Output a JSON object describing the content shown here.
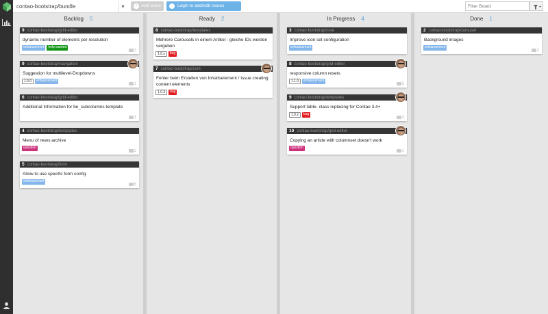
{
  "topbar": {
    "repo": "contao-bootstrap/bundle",
    "add_issue": "Add Issue",
    "login": "Login to add/edit issues",
    "filter_placeholder": "Filter Board"
  },
  "columns": [
    {
      "title": "Backlog",
      "count": "5"
    },
    {
      "title": "Ready",
      "count": "2"
    },
    {
      "title": "In Progress",
      "count": "4"
    },
    {
      "title": "Done",
      "count": "1"
    }
  ],
  "cards": {
    "backlog": [
      {
        "num": "9",
        "repo": "contao-bootstrap/grid-editor",
        "title": "dynamic number of elements per resolution",
        "labels": [
          "enhancement",
          "help wanted"
        ],
        "comments": "2"
      },
      {
        "num": "9",
        "repo": "contao-bootstrap/navigation",
        "title": "Suggestion for multilevel-Dropdowns",
        "labels": [
          "1.0.0",
          "enhancement"
        ],
        "comments": "1"
      },
      {
        "num": "6",
        "repo": "contao-bootstrap/grid-editor",
        "title": "Additional Information for be_subcolumns template",
        "labels": [],
        "comments": "1"
      },
      {
        "num": "4",
        "repo": "contao-bootstrap/templates",
        "title": "Menu of news archive",
        "labels": [
          "question"
        ],
        "comments": "2"
      },
      {
        "num": "5",
        "repo": "contao-bootstrap/form",
        "title": "Allow to use specific form config",
        "labels": [
          "enhancement"
        ],
        "comments": "6"
      }
    ],
    "ready": [
      {
        "num": "8",
        "repo": "contao-bootstrap/templates",
        "title": "Mehrere Carousels in einem Artikel - gleiche IDs werden vergeben",
        "labels": [
          "1.0.x",
          "bug"
        ],
        "comments": ""
      },
      {
        "num": "7",
        "repo": "contao-bootstrap/core",
        "title": "Fehler beim Erstellen von Inhaltselement / Issue creating content elements",
        "labels": [
          "1.0.3",
          "bug"
        ],
        "comments": ""
      }
    ],
    "progress": [
      {
        "num": "3",
        "repo": "contao-bootstrap/core",
        "title": "Improve icon set configuration",
        "labels": [
          "enhancement"
        ],
        "comments": ""
      },
      {
        "num": "8",
        "repo": "contao-bootstrap/grid-editor",
        "title": "responsive column resets",
        "labels": [
          "1.1.0",
          "enhancement"
        ],
        "comments": "5"
      },
      {
        "num": "9",
        "repo": "contao-bootstrap/templates",
        "title": "Support table- class replacing for Contao 3.4+",
        "labels": [
          "1.0.x",
          "bug"
        ],
        "comments": "3"
      },
      {
        "num": "10",
        "repo": "contao-bootstrap/grid-editor",
        "title": "Copying an article with columnset doesn't work",
        "labels": [
          "question"
        ],
        "comments": "1"
      }
    ],
    "done": [
      {
        "num": "2",
        "repo": "contao-bootstrap/carousel",
        "title": "Background images",
        "labels": [
          "enhancement"
        ],
        "comments": "2"
      }
    ]
  },
  "label_colors": {
    "enhancement": "#84b6eb",
    "help wanted": "#159818",
    "bug": "#e11d21",
    "question": "#cc317c"
  },
  "icons": {
    "logo": "huboard-logo-icon",
    "chart": "bar-chart-icon",
    "user": "user-icon",
    "filter": "filter-icon",
    "github": "github-icon"
  }
}
